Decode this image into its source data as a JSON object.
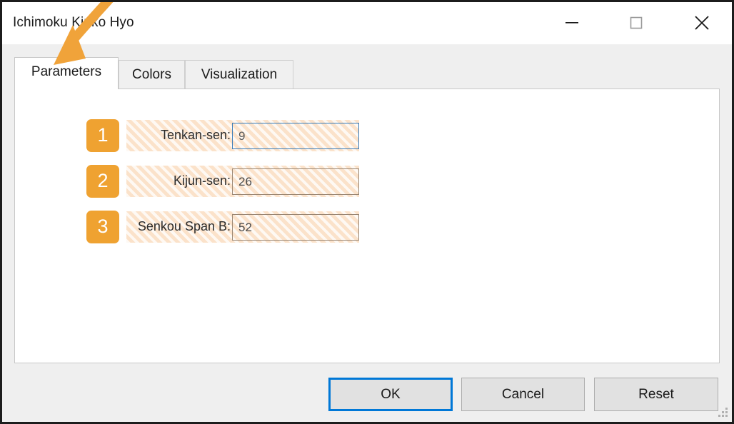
{
  "window": {
    "title": "Ichimoku Kinko Hyo",
    "controls": {
      "minimize": "minimize-icon",
      "maximize": "maximize-icon",
      "close": "close-icon"
    },
    "resize_grip": "resize-grip-icon"
  },
  "tabs": [
    {
      "label": "Parameters",
      "active": true
    },
    {
      "label": "Colors",
      "active": false
    },
    {
      "label": "Visualization",
      "active": false
    }
  ],
  "parameters": {
    "fields": [
      {
        "step": "1",
        "label": "Tenkan-sen:",
        "value": "9",
        "focused": true
      },
      {
        "step": "2",
        "label": "Kijun-sen:",
        "value": "26",
        "focused": false
      },
      {
        "step": "3",
        "label": "Senkou Span B:",
        "value": "52",
        "focused": false
      }
    ]
  },
  "buttons": {
    "ok": "OK",
    "cancel": "Cancel",
    "reset": "Reset"
  },
  "annotation": {
    "arrow": "curved-arrow-pointing-to-parameters-tab",
    "color": "#f0a33a"
  },
  "colors": {
    "badge": "#efa231",
    "highlight_band": "#fbe2ca",
    "focus_blue": "#0078d7",
    "input_focus_border": "#3a7cb8",
    "dialog_background": "#efefef",
    "panel_background": "#ffffff"
  }
}
